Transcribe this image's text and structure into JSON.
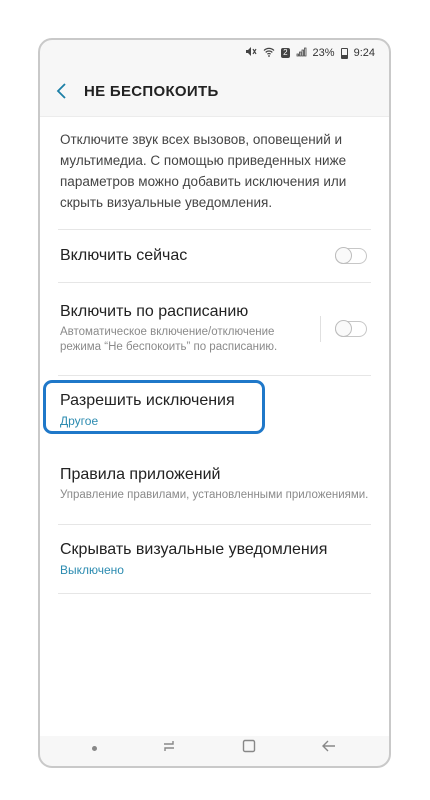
{
  "status": {
    "battery": "23%",
    "time": "9:24",
    "sim": "2"
  },
  "header": {
    "title": "НЕ БЕСПОКОИТЬ"
  },
  "intro": "Отключите звук всех вызовов, оповещений и мультимедиа. С помощью приведенных ниже параметров можно добавить исключения или скрыть визуальные уведомления.",
  "items": [
    {
      "title": "Включить сейчас",
      "toggle_on": false
    },
    {
      "title": "Включить по расписанию",
      "subtitle": "Автоматическое включение/отключение режима “Не беспокоить” по расписанию.",
      "toggle_on": false
    },
    {
      "title": "Разрешить исключения",
      "value": "Другое"
    },
    {
      "title": "Правила приложений",
      "subtitle": "Управление правилами, установленными приложениями."
    },
    {
      "title": "Скрывать визуальные уведомления",
      "value": "Выключено"
    }
  ],
  "colors": {
    "accent": "#2b8bb0",
    "highlight": "#1f78c9"
  },
  "icons": {
    "back": "chevron-left-icon",
    "status": [
      "mute-icon",
      "wifi-icon",
      "signal-icon",
      "battery-icon"
    ],
    "nav": [
      "nav-dot-icon",
      "recents-icon",
      "home-icon",
      "back-arrow-icon"
    ]
  }
}
